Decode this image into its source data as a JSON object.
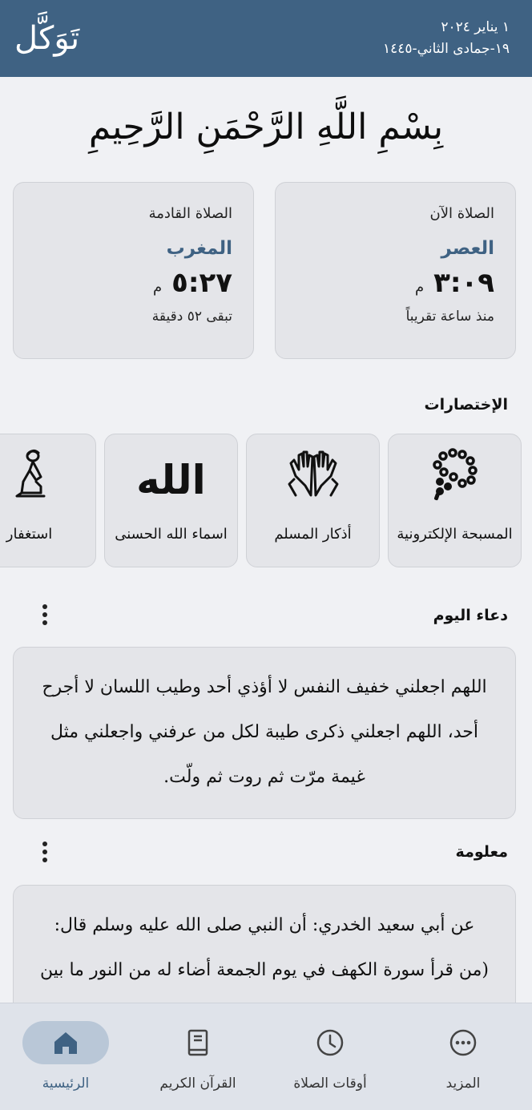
{
  "header": {
    "logo": "تَوَكَّل",
    "gregorian_date": "١ يناير ٢٠٢٤",
    "hijri_date": "١٩-جمادى الثاني-١٤٤٥"
  },
  "basmala": "بِسْمِ اللَّهِ الرَّحْمَنِ الرَّحِيمِ",
  "prayer_now": {
    "label": "الصلاة الآن",
    "name": "العصر",
    "time": "٣:٠٩",
    "ampm": "م",
    "sub": "منذ ساعة تقريباً"
  },
  "prayer_next": {
    "label": "الصلاة القادمة",
    "name": "المغرب",
    "time": "٥:٢٧",
    "ampm": "م",
    "sub": "تبقى ٥٢ دقيقة"
  },
  "shortcuts": {
    "title": "الإختصارات",
    "items": [
      {
        "label": "المسبحة الإلكترونية",
        "icon": "tasbih-beads-icon"
      },
      {
        "label": "أذكار المسلم",
        "icon": "praying-hands-icon"
      },
      {
        "label": "اسماء الله الحسنى",
        "icon": "allah-calligraphy-icon",
        "glyph": "الله"
      },
      {
        "label": "استغفار",
        "icon": "kneeling-person-icon"
      }
    ]
  },
  "dua": {
    "title": "دعاء اليوم",
    "text": "اللهم اجعلني خفيف النفس لا أؤذي أحد وطيب اللسان لا أجرح أحد، اللهم اجعلني ذكرى طيبة لكل من عرفني واجعلني مثل غيمة مرّت ثم روت ثم ولّت."
  },
  "info": {
    "title": "معلومة",
    "text": "عن أبي سعيد الخدري: أن النبي صلى الله عليه وسلم قال: (من قرأ سورة الكهف في يوم الجمعة أضاء له من النور ما بين الجمعتين) رواه الحاكم وصححه الألباني"
  },
  "nav": {
    "items": [
      {
        "label": "الرئيسية",
        "icon": "home-icon",
        "active": true
      },
      {
        "label": "القرآن الكريم",
        "icon": "book-icon",
        "active": false
      },
      {
        "label": "أوقات الصلاة",
        "icon": "clock-icon",
        "active": false
      },
      {
        "label": "المزيد",
        "icon": "more-icon",
        "active": false
      }
    ]
  },
  "colors": {
    "primary": "#3f6283",
    "card": "#e4e5e9",
    "background": "#f0f1f4"
  }
}
